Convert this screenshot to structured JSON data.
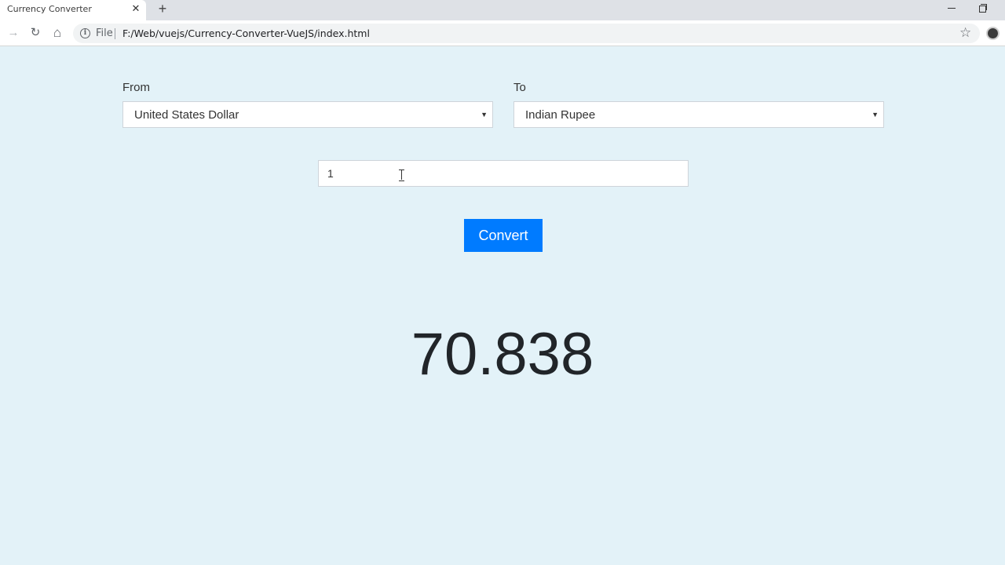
{
  "browser": {
    "tab_title": "Currency Converter",
    "tab_close": "✕",
    "new_tab": "+",
    "back_icon": "→",
    "reload_icon": "↻",
    "home_icon": "⌂",
    "scheme_label": "File",
    "url": "F:/Web/vuejs/Currency-Converter-VueJS/index.html",
    "star_icon": "☆"
  },
  "converter": {
    "from_label": "From",
    "from_value": "United States Dollar",
    "to_label": "To",
    "to_value": "Indian Rupee",
    "amount_value": "1",
    "convert_label": "Convert",
    "result": "70.838"
  },
  "colors": {
    "page_background": "#e3f2f8",
    "button": "#007bff"
  }
}
